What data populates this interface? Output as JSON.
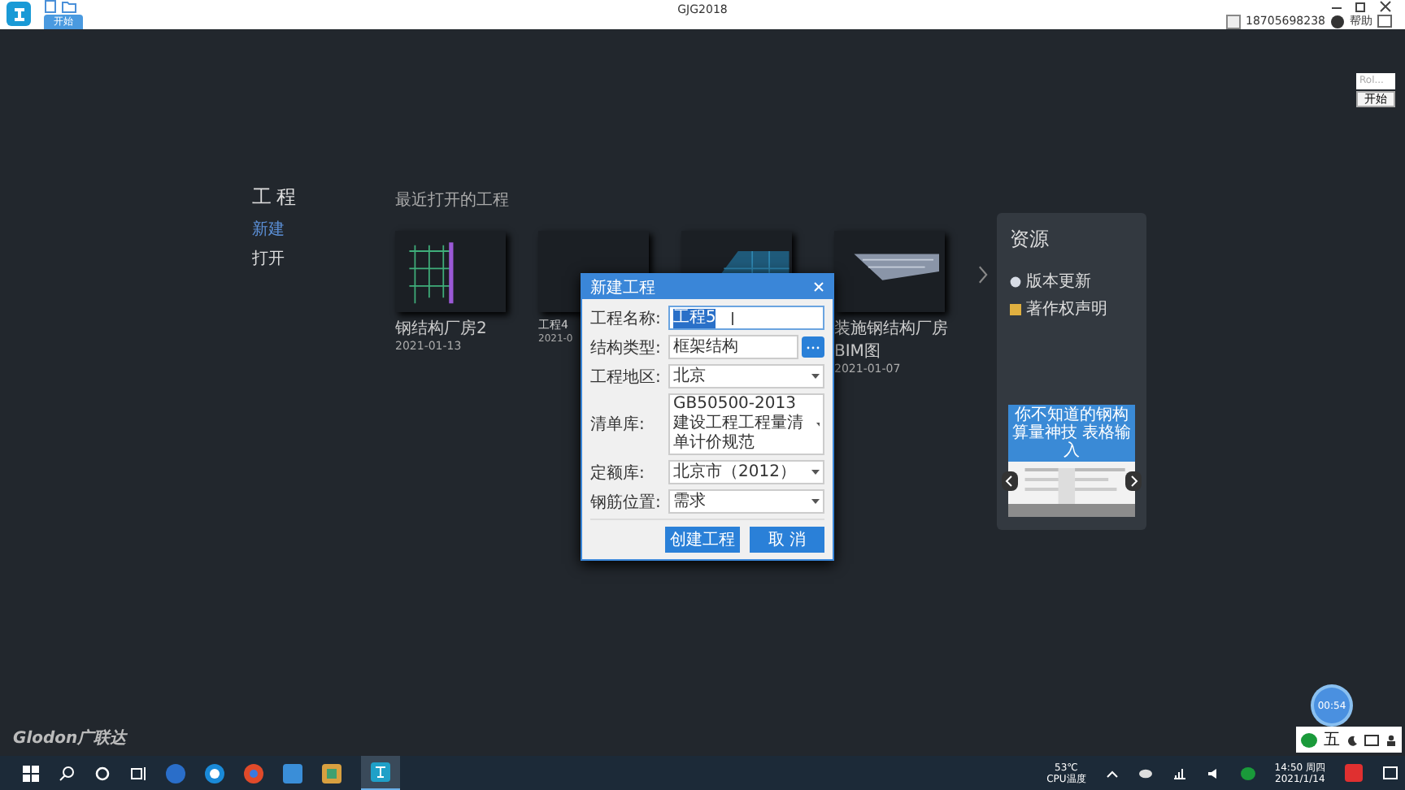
{
  "window": {
    "title": "GJG2018",
    "tab": "开始",
    "phone": "18705698238",
    "help": "帮助"
  },
  "float_widget": {
    "field": "Rol...",
    "button": "开始"
  },
  "sidebar": {
    "title": "工程",
    "items": [
      {
        "label": "新建",
        "selected": true
      },
      {
        "label": "打开",
        "selected": false
      }
    ]
  },
  "recent": {
    "title": "最近打开的工程",
    "projects": [
      {
        "name": "钢结构厂房2",
        "date": "2021-01-13",
        "kind": "picture"
      },
      {
        "name": "工程4",
        "date": "2021-0",
        "kind": "picture"
      },
      {
        "kind": "picture"
      },
      {
        "name": "装施钢结构厂房BIM图",
        "date": "2021-01-07",
        "kind": "picture"
      }
    ]
  },
  "resources": {
    "title": "资源",
    "items": [
      {
        "label": "版本更新",
        "kind": "update"
      },
      {
        "label": "著作权声明",
        "kind": "copyright"
      }
    ],
    "banner": "你不知道的钢构算量神技 表格输入"
  },
  "dialog": {
    "title": "新建工程",
    "fields": [
      {
        "label": "工程名称:",
        "value": "工程5",
        "kind": "text"
      },
      {
        "label": "结构类型:",
        "value": "框架结构",
        "kind": "browse"
      },
      {
        "label": "工程地区:",
        "value": "北京",
        "kind": "select"
      },
      {
        "label": "清单库:",
        "value": "GB50500-2013 建设工程工程量清单计价规范",
        "kind": "select"
      },
      {
        "label": "定额库:",
        "value": "北京市（2012）",
        "kind": "select"
      },
      {
        "label": "钢筋位置:",
        "value": "需求",
        "kind": "select"
      }
    ],
    "buttons": [
      "创建工程",
      "取 消"
    ]
  },
  "brand": "Glodon广联达",
  "timer": "00:54",
  "ime": "五",
  "taskbar": {
    "temp": "53℃",
    "temp_label": "CPU温度",
    "time": "14:50 周四",
    "date": "2021/1/14"
  }
}
